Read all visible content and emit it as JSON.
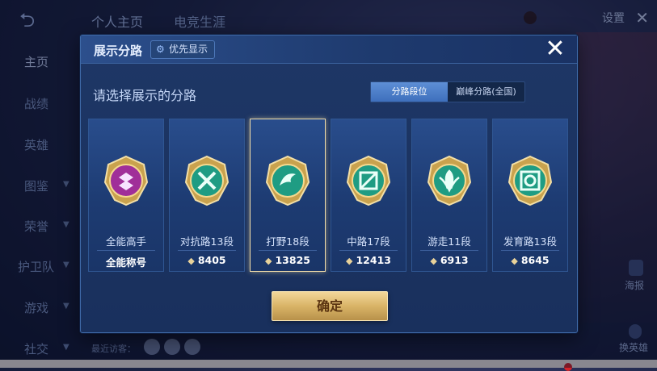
{
  "background": {
    "top_tabs": [
      "个人主页",
      "电竞生涯"
    ],
    "settings_label": "设置",
    "side_nav": [
      {
        "label": "主页",
        "active": true,
        "chevron": false
      },
      {
        "label": "战绩",
        "active": false,
        "chevron": false
      },
      {
        "label": "英雄",
        "active": false,
        "chevron": false
      },
      {
        "label": "图鉴",
        "active": false,
        "chevron": true
      },
      {
        "label": "荣誉",
        "active": false,
        "chevron": true
      },
      {
        "label": "护卫队",
        "active": false,
        "chevron": true
      },
      {
        "label": "游戏",
        "active": false,
        "chevron": true
      },
      {
        "label": "社交",
        "active": false,
        "chevron": true
      }
    ],
    "right_buttons": {
      "poster": "海报",
      "switch_hero": "换英雄"
    },
    "visitors_label": "最近访客："
  },
  "dialog": {
    "title": "展示分路",
    "priority_button": "优先显示",
    "close_icon": "close-icon",
    "subtitle": "请选择展示的分路",
    "toggle": {
      "active": "分路段位",
      "inactive": "巅峰分路(全国)"
    },
    "confirm_label": "确定",
    "cards": [
      {
        "lane": "全能高手",
        "value": "全能称号",
        "has_diamond": false,
        "emblem_color": "#c63fc2",
        "selected": false
      },
      {
        "lane": "对抗路13段",
        "value": "8405",
        "has_diamond": true,
        "emblem_color": "#2fb99a",
        "selected": false
      },
      {
        "lane": "打野18段",
        "value": "13825",
        "has_diamond": true,
        "emblem_color": "#2fb99a",
        "selected": true
      },
      {
        "lane": "中路17段",
        "value": "12413",
        "has_diamond": true,
        "emblem_color": "#2fb99a",
        "selected": false
      },
      {
        "lane": "游走11段",
        "value": "6913",
        "has_diamond": true,
        "emblem_color": "#2fb99a",
        "selected": false
      },
      {
        "lane": "发育路13段",
        "value": "8645",
        "has_diamond": true,
        "emblem_color": "#2fb99a",
        "selected": false
      }
    ]
  }
}
